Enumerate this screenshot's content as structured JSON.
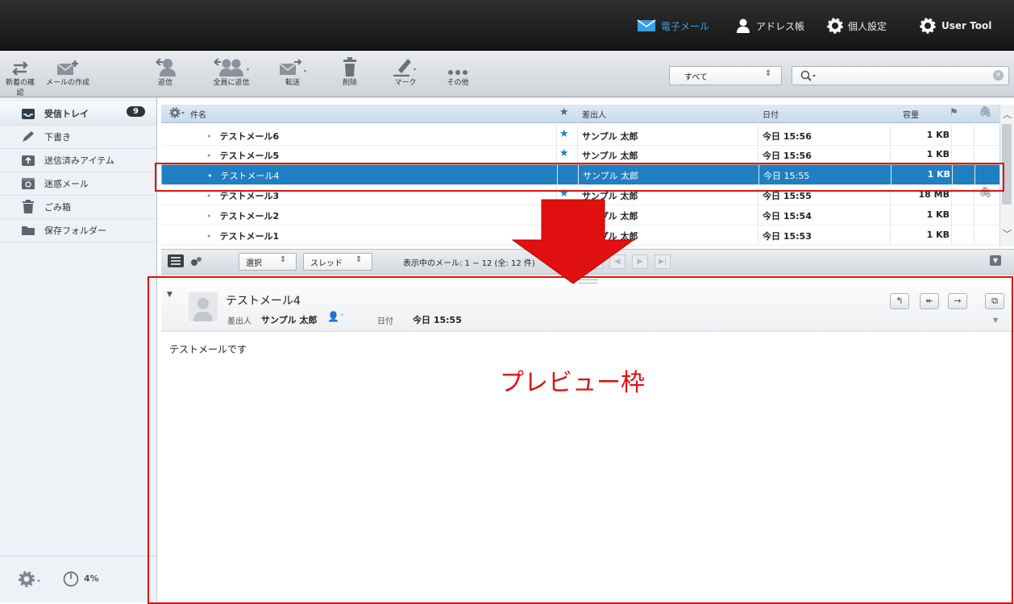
{
  "nav": {
    "mail": "電子メール",
    "addressbook": "アドレス帳",
    "settings": "個人設定",
    "usertool": "User Tool"
  },
  "toolbar": {
    "check": "新着の確認",
    "compose": "メールの作成",
    "reply": "返信",
    "replyall": "全員に返信",
    "forward": "転送",
    "delete": "削除",
    "mark": "マーク",
    "more": "その他",
    "filter_value": "すべて",
    "search_placeholder": ""
  },
  "folders": [
    {
      "label": "受信トレイ",
      "count": "9",
      "icon": "inbox-icon"
    },
    {
      "label": "下書き",
      "icon": "pencil-icon"
    },
    {
      "label": "送信済みアイテム",
      "icon": "sent-icon"
    },
    {
      "label": "迷惑メール",
      "icon": "junk-icon"
    },
    {
      "label": "ごみ箱",
      "icon": "trash-icon"
    },
    {
      "label": "保存フォルダー",
      "icon": "folder-icon"
    }
  ],
  "quota": "4%",
  "list": {
    "headers": {
      "subject": "件名",
      "from": "差出人",
      "date": "日付",
      "size": "容量"
    },
    "rows": [
      {
        "subject": "テストメール6",
        "starred": true,
        "from": "サンプル 太郎",
        "date": "今日 15:56",
        "size": "1 KB",
        "attachment": false,
        "selected": false
      },
      {
        "subject": "テストメール5",
        "starred": true,
        "from": "サンプル 太郎",
        "date": "今日 15:56",
        "size": "1 KB",
        "attachment": false,
        "selected": false
      },
      {
        "subject": "テストメール4",
        "starred": false,
        "from": "サンプル 太郎",
        "date": "今日 15:55",
        "size": "1 KB",
        "attachment": false,
        "selected": true
      },
      {
        "subject": "テストメール3",
        "starred": true,
        "from": "サンプル 太郎",
        "date": "今日 15:55",
        "size": "18 MB",
        "attachment": true,
        "selected": false
      },
      {
        "subject": "テストメール2",
        "starred": false,
        "from": "サンプル 太郎",
        "date": "今日 15:54",
        "size": "1 KB",
        "attachment": false,
        "selected": false
      },
      {
        "subject": "テストメール1",
        "starred": false,
        "from": "サンプル 太郎",
        "date": "今日 15:53",
        "size": "1 KB",
        "attachment": false,
        "selected": false
      }
    ]
  },
  "statusbar": {
    "select": "選択",
    "thread": "スレッド",
    "count_text": "表示中のメール: 1 ~ 12 (全: 12 件)"
  },
  "preview": {
    "subject": "テストメール4",
    "from_label": "差出人",
    "from": "サンプル 太郎",
    "date_label": "日付",
    "date": "今日 15:55",
    "body": "テストメールです"
  },
  "annotation": {
    "label": "プレビュー枠",
    "color": "#e01010"
  },
  "colors": {
    "accent": "#1f7fc2",
    "topbar": "#1e1e1e"
  }
}
